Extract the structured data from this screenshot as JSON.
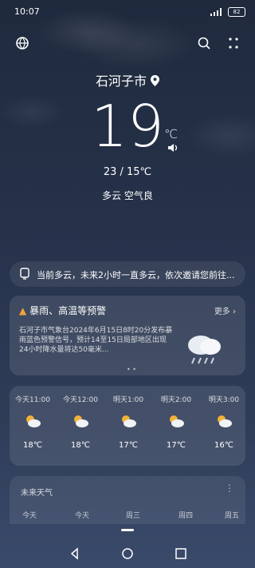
{
  "status": {
    "time": "10:07",
    "battery": "82"
  },
  "location": {
    "city": "石河子市"
  },
  "current": {
    "temp": "19",
    "unit": "℃",
    "range": "23 / 15℃",
    "condition": "多云  空气良"
  },
  "forecast_strip": {
    "text": "当前多云，未来2小时一直多云，依次邀请您前往..."
  },
  "alert": {
    "title": "暴雨、高温等预警",
    "more": "更多 ›",
    "body": "石河子市气象台2024年6月15日8时20分发布暴雨蓝色预警信号，预计14至15日局部地区出现24小时降水量将达50毫米..."
  },
  "hourly": [
    {
      "time": "今天11:00",
      "temp": "18℃"
    },
    {
      "time": "今天12:00",
      "temp": "18℃"
    },
    {
      "time": "明天1:00",
      "temp": "17℃"
    },
    {
      "time": "明天2:00",
      "temp": "17℃"
    },
    {
      "time": "明天3:00",
      "temp": "16℃"
    }
  ],
  "daily": {
    "label": "未来天气",
    "days": [
      "今天",
      "今天",
      "周三",
      "周四",
      "周五"
    ]
  },
  "colors": {
    "bg_top": "#1f2a3d",
    "bg_bottom": "#3a4a6a"
  }
}
